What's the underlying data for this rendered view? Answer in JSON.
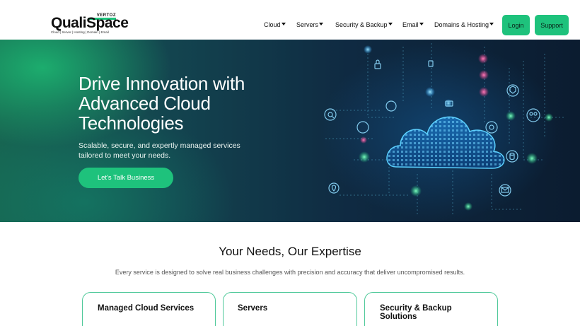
{
  "brand": {
    "name": "QualiSpace",
    "badge": "VERTOZ",
    "tagline": "Cloud | Server | Hosting | Domain | Email"
  },
  "nav": {
    "items": [
      {
        "label": "Cloud"
      },
      {
        "label": "Servers"
      },
      {
        "label": "Security & Backup"
      },
      {
        "label": "Email"
      },
      {
        "label": "Domains & Hosting"
      }
    ],
    "login_label": "Login",
    "support_label": "Support"
  },
  "hero": {
    "title": "Drive Innovation with Advanced Cloud Technologies",
    "subtitle": "Scalable, secure, and expertly managed services tailored to meet your needs.",
    "cta_label": "Let's Talk Business"
  },
  "expertise": {
    "title": "Your Needs, Our Expertise",
    "subtitle": "Every service is designed to solve real business challenges with precision and accuracy that deliver uncompromised results.",
    "cards": [
      {
        "title": "Managed Cloud Services"
      },
      {
        "title": "Servers"
      },
      {
        "title": "Security & Backup Solutions"
      }
    ]
  },
  "colors": {
    "accent": "#1ec27c",
    "hero_dark": "#0b1c30",
    "card_border": "#4fc99a"
  },
  "icons": [
    "caret-down-icon",
    "cloud-icon",
    "lock-icon",
    "shield-icon",
    "mail-icon",
    "database-icon",
    "user-group-icon",
    "search-icon",
    "location-icon"
  ]
}
